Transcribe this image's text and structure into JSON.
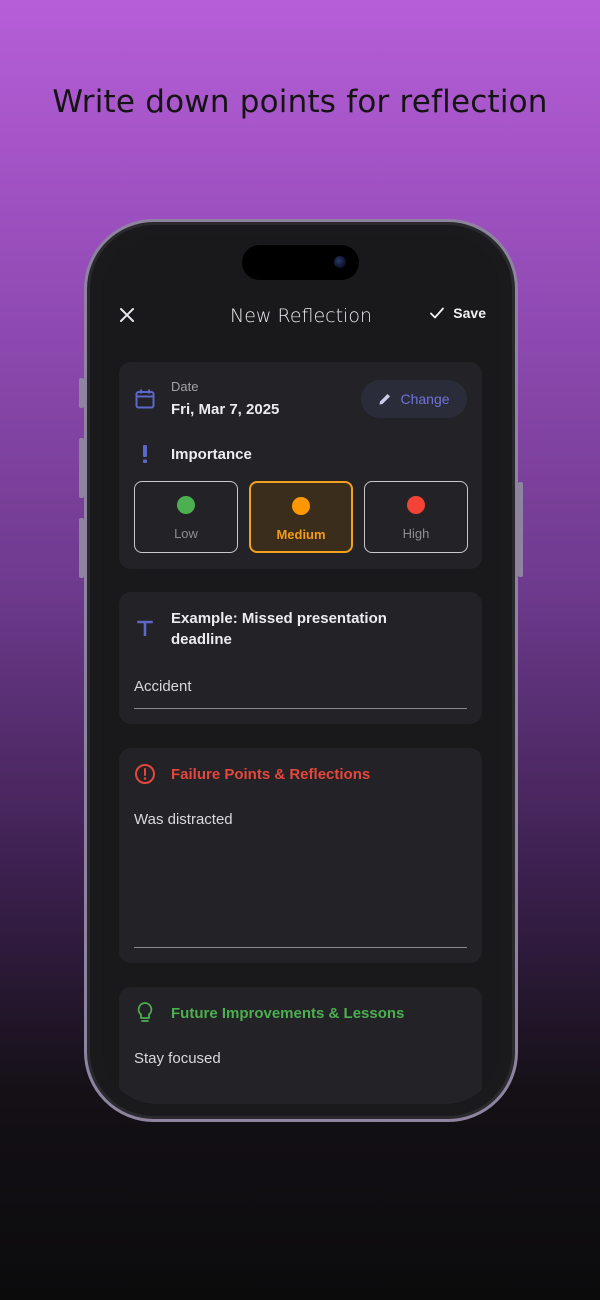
{
  "headline": "Write down points for reflection",
  "nav": {
    "title": "New Reflection",
    "save_label": "Save"
  },
  "date_card": {
    "date_label": "Date",
    "date_value": "Fri, Mar 7, 2025",
    "change_label": "Change",
    "importance_label": "Importance",
    "options": [
      {
        "label": "Low",
        "color": "#4caf50",
        "selected": false
      },
      {
        "label": "Medium",
        "color": "#ff9800",
        "selected": true
      },
      {
        "label": "High",
        "color": "#f44336",
        "selected": false
      }
    ]
  },
  "title_card": {
    "placeholder": "Example: Missed presentation deadline",
    "value": "Accident"
  },
  "failure_card": {
    "title": "Failure Points & Reflections",
    "value": "Was distracted",
    "accent": "#e5473c"
  },
  "improve_card": {
    "title": "Future Improvements & Lessons",
    "value": "Stay focused",
    "accent": "#4caf50"
  },
  "colors": {
    "indigo": "#5c67c9",
    "card": "#232226",
    "screen": "#19191b"
  }
}
